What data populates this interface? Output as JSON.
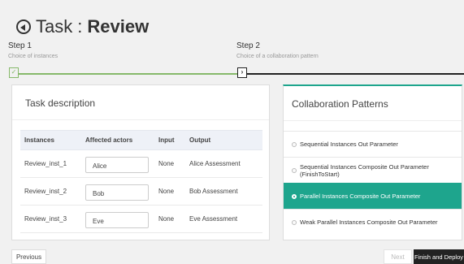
{
  "header": {
    "prefix": "Task",
    "separator": ":",
    "task_name": "Review"
  },
  "steps": [
    {
      "label": "Step 1",
      "sub": "Choice of instances",
      "status": "done"
    },
    {
      "label": "Step 2",
      "sub": "Choice of a collaboration pattern",
      "status": "current"
    }
  ],
  "task_description": {
    "heading": "Task description",
    "columns": [
      "Instances",
      "Affected actors",
      "Input",
      "Output"
    ],
    "rows": [
      {
        "instance": "Review_inst_1",
        "actor": "Alice",
        "input": "None",
        "output": "Alice Assessment"
      },
      {
        "instance": "Review_inst_2",
        "actor": "Bob",
        "input": "None",
        "output": "Bob Assessment"
      },
      {
        "instance": "Review_inst_3",
        "actor": "Eve",
        "input": "None",
        "output": "Eve Assessment"
      }
    ]
  },
  "collaboration": {
    "heading": "Collaboration Patterns",
    "accent_color": "#1ea58d",
    "patterns": [
      {
        "label": "Sequential Instances Out Parameter",
        "selected": false
      },
      {
        "label": "Sequential Instances Composite Out Parameter (FinishToStart)",
        "selected": false
      },
      {
        "label": "Parallel Instances Composite Out Parameter",
        "selected": true
      },
      {
        "label": "Weak Parallel Instances Composite Out Parameter",
        "selected": false
      }
    ]
  },
  "footer": {
    "previous_label": "Previous",
    "next_label": "Next",
    "finish_label": "Finish and Deploy"
  }
}
